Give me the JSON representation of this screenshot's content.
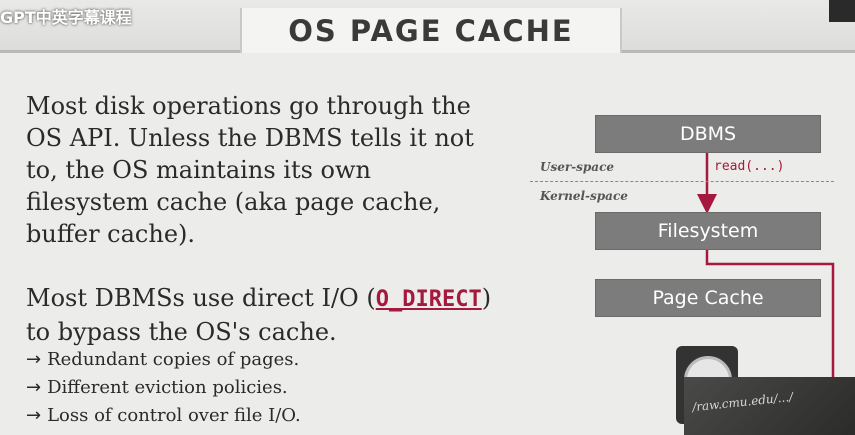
{
  "watermark": "GPT中英字幕课程",
  "title": "OS PAGE CACHE",
  "paragraph1": "Most disk operations go through the OS API. Unless the DBMS tells it not to, the OS maintains its own filesystem cache (aka page cache, buffer cache).",
  "paragraph2": {
    "before": "Most DBMSs use direct I/O (",
    "code": "O_DIRECT",
    "after": ") to bypass the OS's cache."
  },
  "bullets": [
    {
      "arrow": "→",
      "text": "Redundant copies of pages."
    },
    {
      "arrow": "→",
      "text": "Different eviction policies."
    },
    {
      "arrow": "→",
      "text": "Loss of control over file I/O."
    }
  ],
  "diagram": {
    "dbms_label": "DBMS",
    "user_space_label": "User-space",
    "kernel_space_label": "Kernel-space",
    "read_call": "read(...)",
    "filesystem_label": "Filesystem",
    "page_cache_label": "Page Cache",
    "arrow_color": "#a4193d",
    "box_color": "#7c7c7c"
  },
  "webcam_scrawl": "/raw.cmu.edu/.../"
}
